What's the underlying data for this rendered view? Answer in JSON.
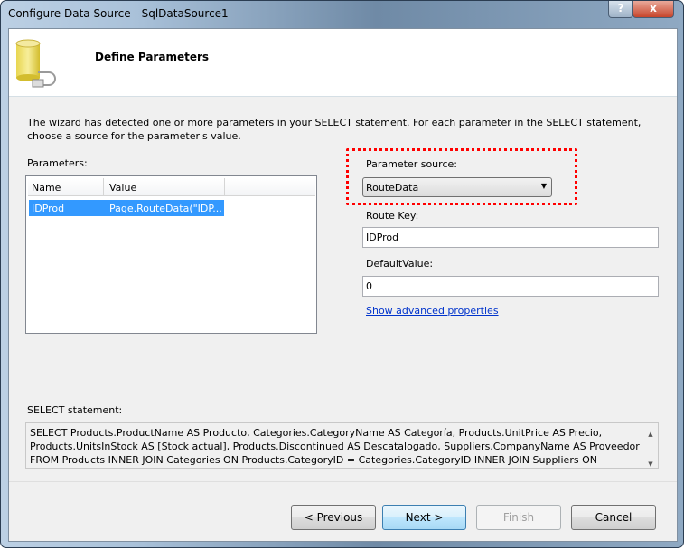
{
  "window": {
    "title": "Configure Data Source - SqlDataSource1",
    "help_label": "?",
    "close_label": "x"
  },
  "header": {
    "title": "Define Parameters",
    "icon": "database-plug-icon"
  },
  "intro": "The wizard has detected one or more parameters in your SELECT statement. For each parameter in the SELECT statement, choose a source for the parameter's value.",
  "parameters": {
    "label": "Parameters:",
    "columns": [
      "Name",
      "Value"
    ],
    "rows": [
      {
        "name": "IDProd",
        "value": "Page.RouteData(\"IDP..."
      }
    ]
  },
  "source": {
    "label": "Parameter source:",
    "value": "RouteData",
    "highlight_color": "#ff0000"
  },
  "route_key": {
    "label": "Route Key:",
    "value": "IDProd"
  },
  "default_value": {
    "label": "DefaultValue:",
    "value": "0"
  },
  "advanced_link": "Show advanced properties",
  "select": {
    "label": "SELECT statement:",
    "lines": [
      "SELECT Products.ProductName AS Producto, Categories.CategoryName AS Categoría, Products.UnitPrice AS Precio,",
      "Products.UnitsInStock AS [Stock actual], Products.Discontinued AS Descatalogado, Suppliers.CompanyName AS Proveedor",
      "FROM Products INNER JOIN Categories ON Products.CategoryID = Categories.CategoryID INNER JOIN Suppliers ON"
    ]
  },
  "buttons": {
    "previous": "< Previous",
    "next": "Next >",
    "finish": "Finish",
    "cancel": "Cancel"
  }
}
